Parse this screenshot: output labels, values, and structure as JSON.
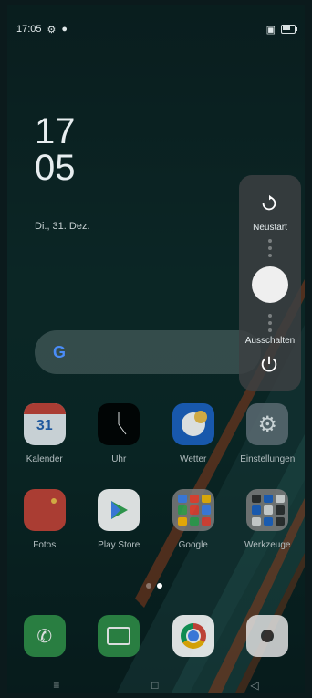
{
  "status": {
    "time": "17:05",
    "battery_level": 0.7
  },
  "clock": {
    "hour": "17",
    "minute": "05",
    "date": "Di., 31. Dez."
  },
  "search": {
    "logo": "G"
  },
  "apps_row1": [
    {
      "label": "Kalender",
      "icon": "calendar-icon",
      "badge": "31",
      "color": "#c74237"
    },
    {
      "label": "Uhr",
      "icon": "clock-icon",
      "color": "#000000"
    },
    {
      "label": "Wetter",
      "icon": "weather-icon",
      "color": "#1b61c4"
    },
    {
      "label": "Einstellungen",
      "icon": "settings-icon",
      "color": "#5b6a72"
    }
  ],
  "apps_row2": [
    {
      "label": "Fotos",
      "icon": "photos-icon",
      "color": "#c74237"
    },
    {
      "label": "Play Store",
      "icon": "play-store-icon",
      "color": "#ffffff"
    },
    {
      "label": "Google",
      "icon": "google-folder-icon",
      "color": "#7c7c7c"
    },
    {
      "label": "Werkzeuge",
      "icon": "tools-folder-icon",
      "color": "#7c7c7c"
    }
  ],
  "dock": [
    {
      "icon": "phone-icon",
      "color": "#2f8f48"
    },
    {
      "icon": "messages-icon",
      "color": "#2f8f48"
    },
    {
      "icon": "chrome-icon",
      "color": "#ffffff"
    },
    {
      "icon": "camera-icon",
      "color": "#e0e0e0"
    }
  ],
  "power_menu": {
    "restart_label": "Neustart",
    "power_off_label": "Ausschalten"
  }
}
